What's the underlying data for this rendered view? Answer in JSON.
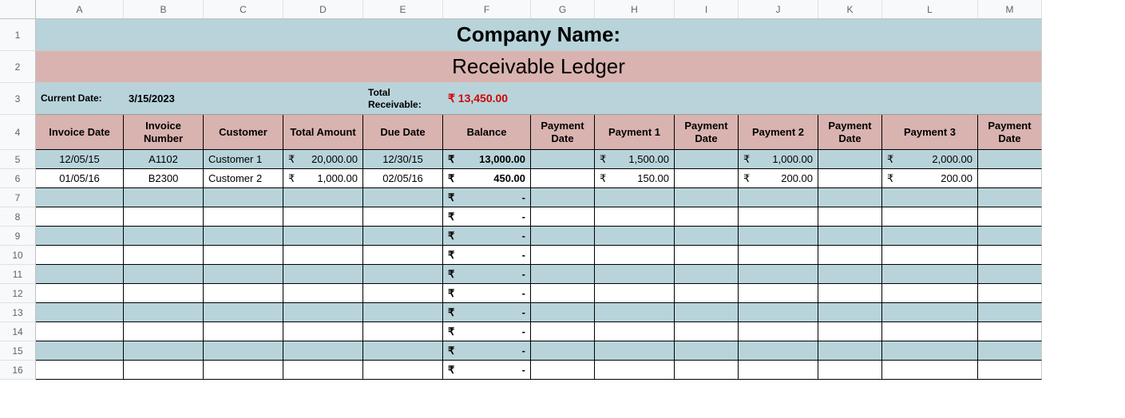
{
  "columns": [
    "A",
    "B",
    "C",
    "D",
    "E",
    "F",
    "G",
    "H",
    "I",
    "J",
    "K",
    "L",
    "M"
  ],
  "row_numbers": [
    1,
    2,
    3,
    4,
    5,
    6,
    7,
    8,
    9,
    10,
    11,
    12,
    13,
    14,
    15,
    16
  ],
  "title": "Company Name:",
  "subtitle": "Receivable Ledger",
  "meta": {
    "current_date_label": "Current Date:",
    "current_date": "3/15/2023",
    "total_receivable_label": "Total Receivable:",
    "total_receivable": "₹ 13,450.00"
  },
  "headers": [
    "Invoice Date",
    "Invoice Number",
    "Customer",
    "Total Amount",
    "Due Date",
    "Balance",
    "Payment Date",
    "Payment 1",
    "Payment Date",
    "Payment 2",
    "Payment Date",
    "Payment 3",
    "Payment Date"
  ],
  "rows": [
    {
      "invoice_date": "12/05/15",
      "invoice_number": "A1102",
      "customer": "Customer 1",
      "total_amount": "20,000.00",
      "due_date": "12/30/15",
      "balance": "13,000.00",
      "pd1": "",
      "p1": "1,500.00",
      "pd2": "",
      "p2": "1,000.00",
      "pd3": "",
      "p3": "2,000.00",
      "pd4": ""
    },
    {
      "invoice_date": "01/05/16",
      "invoice_number": "B2300",
      "customer": "Customer 2",
      "total_amount": "1,000.00",
      "due_date": "02/05/16",
      "balance": "450.00",
      "pd1": "",
      "p1": "150.00",
      "pd2": "",
      "p2": "200.00",
      "pd3": "",
      "p3": "200.00",
      "pd4": ""
    },
    {
      "invoice_date": "",
      "invoice_number": "",
      "customer": "",
      "total_amount": "",
      "due_date": "",
      "balance": "-",
      "pd1": "",
      "p1": "",
      "pd2": "",
      "p2": "",
      "pd3": "",
      "p3": "",
      "pd4": ""
    },
    {
      "invoice_date": "",
      "invoice_number": "",
      "customer": "",
      "total_amount": "",
      "due_date": "",
      "balance": "-",
      "pd1": "",
      "p1": "",
      "pd2": "",
      "p2": "",
      "pd3": "",
      "p3": "",
      "pd4": ""
    },
    {
      "invoice_date": "",
      "invoice_number": "",
      "customer": "",
      "total_amount": "",
      "due_date": "",
      "balance": "-",
      "pd1": "",
      "p1": "",
      "pd2": "",
      "p2": "",
      "pd3": "",
      "p3": "",
      "pd4": ""
    },
    {
      "invoice_date": "",
      "invoice_number": "",
      "customer": "",
      "total_amount": "",
      "due_date": "",
      "balance": "-",
      "pd1": "",
      "p1": "",
      "pd2": "",
      "p2": "",
      "pd3": "",
      "p3": "",
      "pd4": ""
    },
    {
      "invoice_date": "",
      "invoice_number": "",
      "customer": "",
      "total_amount": "",
      "due_date": "",
      "balance": "-",
      "pd1": "",
      "p1": "",
      "pd2": "",
      "p2": "",
      "pd3": "",
      "p3": "",
      "pd4": ""
    },
    {
      "invoice_date": "",
      "invoice_number": "",
      "customer": "",
      "total_amount": "",
      "due_date": "",
      "balance": "-",
      "pd1": "",
      "p1": "",
      "pd2": "",
      "p2": "",
      "pd3": "",
      "p3": "",
      "pd4": ""
    },
    {
      "invoice_date": "",
      "invoice_number": "",
      "customer": "",
      "total_amount": "",
      "due_date": "",
      "balance": "-",
      "pd1": "",
      "p1": "",
      "pd2": "",
      "p2": "",
      "pd3": "",
      "p3": "",
      "pd4": ""
    },
    {
      "invoice_date": "",
      "invoice_number": "",
      "customer": "",
      "total_amount": "",
      "due_date": "",
      "balance": "-",
      "pd1": "",
      "p1": "",
      "pd2": "",
      "p2": "",
      "pd3": "",
      "p3": "",
      "pd4": ""
    },
    {
      "invoice_date": "",
      "invoice_number": "",
      "customer": "",
      "total_amount": "",
      "due_date": "",
      "balance": "-",
      "pd1": "",
      "p1": "",
      "pd2": "",
      "p2": "",
      "pd3": "",
      "p3": "",
      "pd4": ""
    },
    {
      "invoice_date": "",
      "invoice_number": "",
      "customer": "",
      "total_amount": "",
      "due_date": "",
      "balance": "-",
      "pd1": "",
      "p1": "",
      "pd2": "",
      "p2": "",
      "pd3": "",
      "p3": "",
      "pd4": ""
    }
  ],
  "currency": "₹",
  "chart_data": {
    "type": "table",
    "title": "Receivable Ledger",
    "columns": [
      "Invoice Date",
      "Invoice Number",
      "Customer",
      "Total Amount",
      "Due Date",
      "Balance",
      "Payment 1",
      "Payment 2",
      "Payment 3"
    ],
    "rows": [
      [
        "12/05/15",
        "A1102",
        "Customer 1",
        20000.0,
        "12/30/15",
        13000.0,
        1500.0,
        1000.0,
        2000.0
      ],
      [
        "01/05/16",
        "B2300",
        "Customer 2",
        1000.0,
        "02/05/16",
        450.0,
        150.0,
        200.0,
        200.0
      ]
    ],
    "total_receivable": 13450.0,
    "currency": "INR"
  }
}
